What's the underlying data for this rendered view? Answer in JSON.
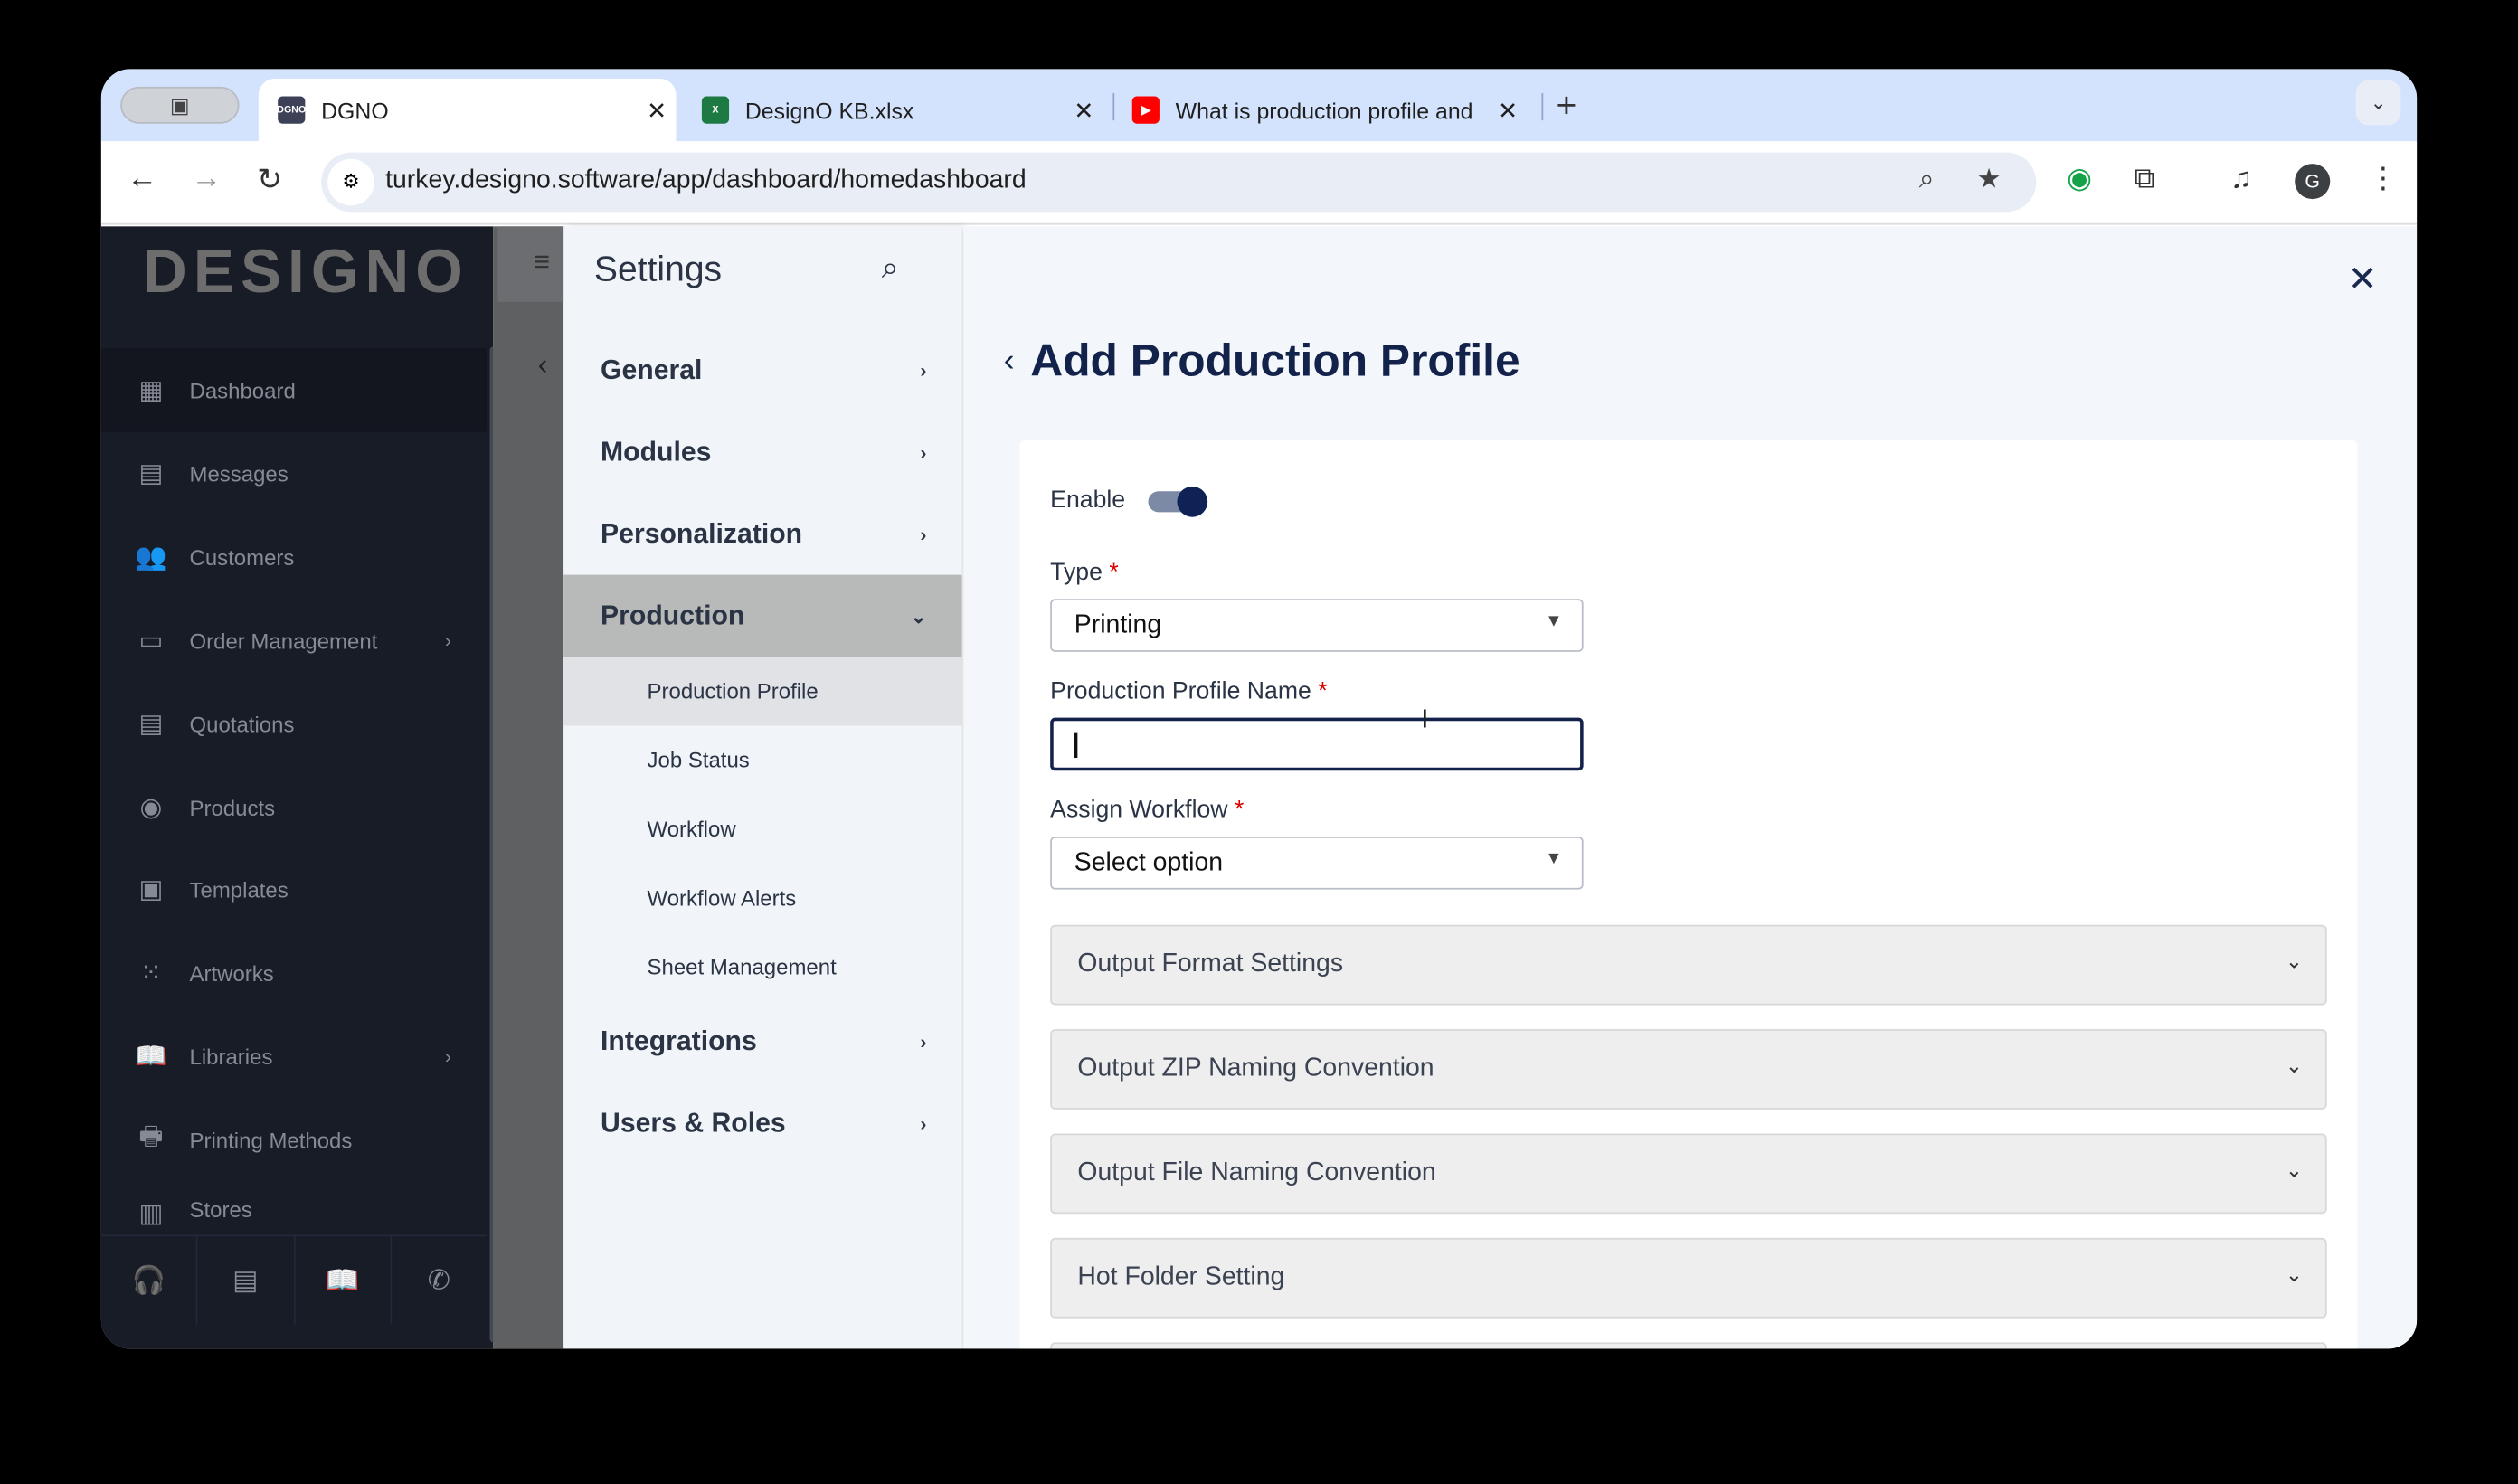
{
  "browser": {
    "tabs": [
      {
        "title": "DGNO",
        "favicon": "DGNO",
        "active": true
      },
      {
        "title": "DesignO KB.xlsx",
        "favicon": "excel-icon"
      },
      {
        "title": "What is production profile and",
        "favicon": "youtube-icon"
      }
    ],
    "url": "turkey.designo.software/app/dashboard/homedashboard",
    "avatar_letter": "G"
  },
  "sidebar": {
    "logo": "DESIGNO",
    "items": [
      {
        "label": "Dashboard",
        "icon": "dashboard-icon",
        "active": true
      },
      {
        "label": "Messages",
        "icon": "messages-icon"
      },
      {
        "label": "Customers",
        "icon": "customers-icon"
      },
      {
        "label": "Order Management",
        "icon": "card-icon",
        "chevron": true
      },
      {
        "label": "Quotations",
        "icon": "clipboard-icon"
      },
      {
        "label": "Products",
        "icon": "products-icon"
      },
      {
        "label": "Templates",
        "icon": "templates-icon"
      },
      {
        "label": "Artworks",
        "icon": "artworks-icon"
      },
      {
        "label": "Libraries",
        "icon": "libraries-icon",
        "chevron": true
      },
      {
        "label": "Printing Methods",
        "icon": "printer-icon"
      },
      {
        "label": "Stores",
        "icon": "store-icon"
      }
    ]
  },
  "settings": {
    "title": "Settings",
    "groups": [
      {
        "label": "General"
      },
      {
        "label": "Modules"
      },
      {
        "label": "Personalization"
      },
      {
        "label": "Production",
        "open": true
      },
      {
        "label": "Integrations"
      },
      {
        "label": "Users & Roles"
      }
    ],
    "production_items": [
      "Production Profile",
      "Job Status",
      "Workflow",
      "Workflow Alerts",
      "Sheet Management"
    ],
    "selected": "Production Profile"
  },
  "form": {
    "title": "Add Production Profile",
    "enable_label": "Enable",
    "enabled": true,
    "type_label": "Type",
    "type_value": "Printing",
    "name_label": "Production Profile Name",
    "name_value": "",
    "workflow_label": "Assign Workflow",
    "workflow_value": "Select option",
    "required_mark": "*",
    "sections": [
      "Output Format Settings",
      "Output ZIP Naming Convention",
      "Output File Naming Convention",
      "Hot Folder Setting"
    ]
  }
}
